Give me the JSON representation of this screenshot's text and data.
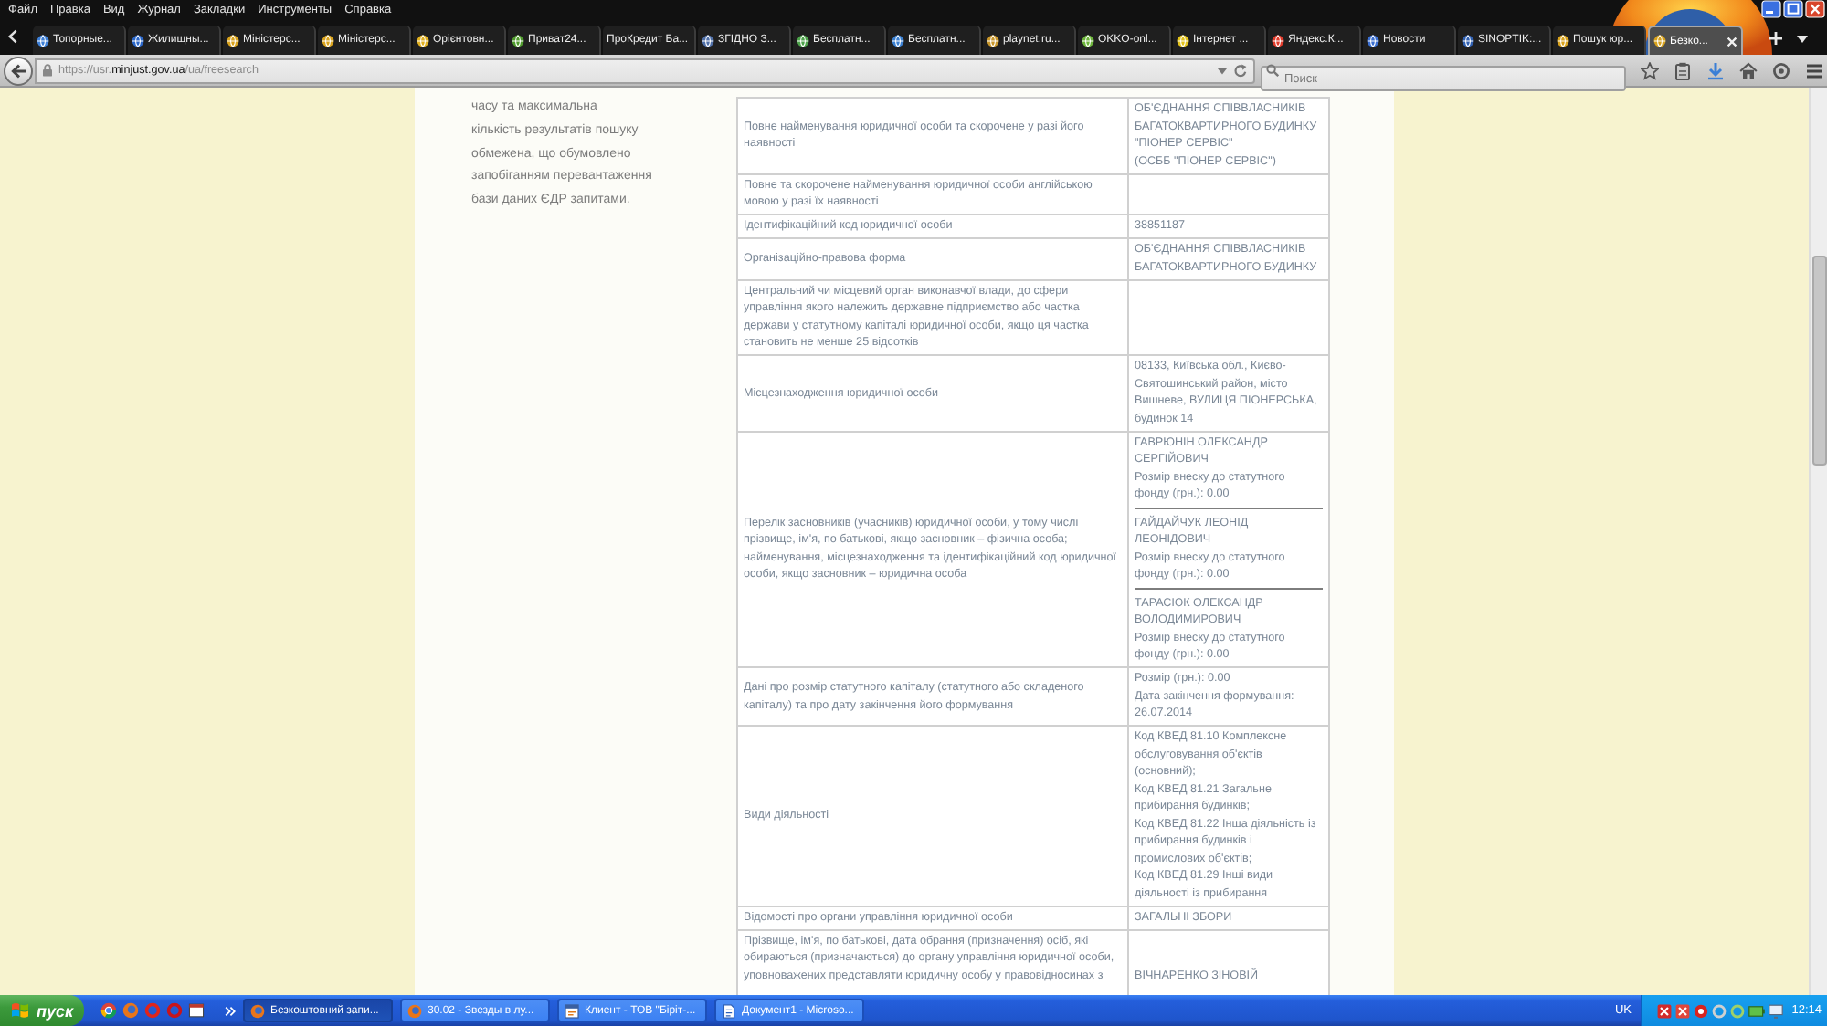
{
  "menu": [
    "Файл",
    "Правка",
    "Вид",
    "Журнал",
    "Закладки",
    "Инструменты",
    "Справка"
  ],
  "tabs": [
    {
      "label": "Топорные...",
      "favicon": true,
      "selected": false
    },
    {
      "label": "Жилищны...",
      "favicon": true,
      "selected": false
    },
    {
      "label": "Міністерс...",
      "favicon": true,
      "selected": false
    },
    {
      "label": "Міністерс...",
      "favicon": true,
      "selected": false
    },
    {
      "label": "Орієнтовн...",
      "favicon": true,
      "selected": false
    },
    {
      "label": "Приват24...",
      "favicon": true,
      "selected": false
    },
    {
      "label": "ПроКредит Ба...",
      "favicon": false,
      "selected": false
    },
    {
      "label": "ЗГІДНО З...",
      "favicon": true,
      "selected": false
    },
    {
      "label": "Бесплатн...",
      "favicon": true,
      "selected": false
    },
    {
      "label": "Бесплатн...",
      "favicon": true,
      "selected": false
    },
    {
      "label": "playnet.ru...",
      "favicon": true,
      "selected": false
    },
    {
      "label": "OKKO-onl...",
      "favicon": true,
      "selected": false
    },
    {
      "label": "Інтернет ...",
      "favicon": true,
      "selected": false
    },
    {
      "label": "Яндекс.К...",
      "favicon": true,
      "selected": false
    },
    {
      "label": "Новости",
      "favicon": true,
      "selected": false
    },
    {
      "label": "SINOPTIK:...",
      "favicon": true,
      "selected": false
    },
    {
      "label": "Пошук юр...",
      "favicon": true,
      "selected": false
    },
    {
      "label": "Безко...",
      "favicon": true,
      "selected": true
    }
  ],
  "address_bar": {
    "url": "https://usr.**minjust.gov.ua**/ua/freesearch"
  },
  "search": {
    "placeholder": "Поиск"
  },
  "notice": {
    "lines": [
      "часу та максимальна",
      "кількість результатів пошуку",
      "обмежена, що обумовлено",
      "запобіганням перевантаження",
      "бази даних ЄДР запитами."
    ]
  },
  "record": {
    "rows": [
      {
        "kind": "text",
        "label": "Повне найменування юридичної особи та скорочене у разі його наявності",
        "values": [
          "ОБ'ЄДНАННЯ СПІВВЛАСНИКІВ БАГАТОКВАРТИРНОГО БУДИНКУ \"ПІОНЕР СЕРВІС\"",
          "(ОСББ \"ПІОНЕР СЕРВІС\")"
        ]
      },
      {
        "kind": "text",
        "label": "Повне та скорочене найменування юридичної особи англійською мовою у разі їх наявності"
      },
      {
        "kind": "text",
        "label": "Ідентифікаційний код юридичної особи",
        "values": [
          "38851187"
        ]
      },
      {
        "kind": "text",
        "label": "Організаційно-правова форма",
        "values": [
          "ОБ'ЄДНАННЯ СПІВВЛАСНИКІВ БАГАТОКВАРТИРНОГО БУДИНКУ"
        ]
      },
      {
        "kind": "text",
        "label": "Центральний чи місцевий орган виконавчої влади, до сфери управління якого належить державне підприємство або частка держави у статутному капіталі юридичної особи, якщо ця частка становить не менше 25 відсотків"
      },
      {
        "kind": "text",
        "label": "Місцезнаходження юридичної особи",
        "values": [
          "08133, Київська обл., Києво-Святошинський район, місто Вишневе, ВУЛИЦЯ ПІОНЕРСЬКА, будинок 14"
        ]
      },
      {
        "kind": "founders",
        "label": "Перелік засновників (учасників) юридичної особи, у тому числі прізвище, ім'я, по батькові, якщо засновник – фізична особа; найменування, місцезнаходження та ідентифікаційний код юридичної особи, якщо засновник – юридична особа",
        "founders": [
          {
            "name": "ГАВРЮНІН ОЛЕКСАНДР СЕРГІЙОВИЧ",
            "contribution": "Розмір внеску до статутного фонду (грн.): 0.00"
          },
          {
            "name": "ГАЙДАЙЧУК ЛЕОНІД ЛЕОНІДОВИЧ",
            "contribution": "Розмір внеску до статутного фонду (грн.): 0.00"
          },
          {
            "name": "ТАРАСЮК ОЛЕКСАНДР ВОЛОДИМИРОВИЧ",
            "contribution": "Розмір внеску до статутного фонду (грн.): 0.00"
          }
        ]
      },
      {
        "kind": "text",
        "label": "Дані про розмір статутного капіталу (статутного або складеного капіталу) та про дату закінчення його формування",
        "values": [
          "Розмір (грн.): 0.00",
          "Дата закінчення формування: 26.07.2014"
        ]
      },
      {
        "kind": "text",
        "label": "Види діяльності",
        "values": [
          "Код КВЕД 81.10 Комплексне обслуговування об'єктів (основний);",
          "Код КВЕД 81.21 Загальне прибирання будинків;",
          "Код КВЕД 81.22 Інша діяльність із прибирання будинків і промислових об'єктів;",
          "Код КВЕД 81.29 Інші види діяльності із прибирання"
        ]
      },
      {
        "kind": "text",
        "label": "Відомості про органи управління юридичної особи",
        "values": [
          "ЗАГАЛЬНІ ЗБОРИ"
        ]
      },
      {
        "kind": "text",
        "label": "Прізвище, ім'я, по батькові, дата обрання (призначення) осіб, які обираються (призначаються) до органу управління юридичної особи, уповноважених представляти юридичну особу у правовідносинах з",
        "values": [
          "ВІЧНАРЕНКО ЗІНОВІЙ"
        ]
      }
    ]
  },
  "taskbar": {
    "start": "пуск",
    "tasks": [
      {
        "kind": "browser",
        "label": "Безкоштовний запи...",
        "selected": true
      },
      {
        "kind": "browser",
        "label": "30.02 - Звезды в лу...",
        "selected": false
      },
      {
        "kind": "app",
        "label": "Клиент - ТОВ \"Біріт-...",
        "selected": false
      },
      {
        "kind": "document",
        "label": "Документ1 - Microso...",
        "selected": false
      }
    ],
    "language": "UK",
    "clock": "12:14"
  }
}
